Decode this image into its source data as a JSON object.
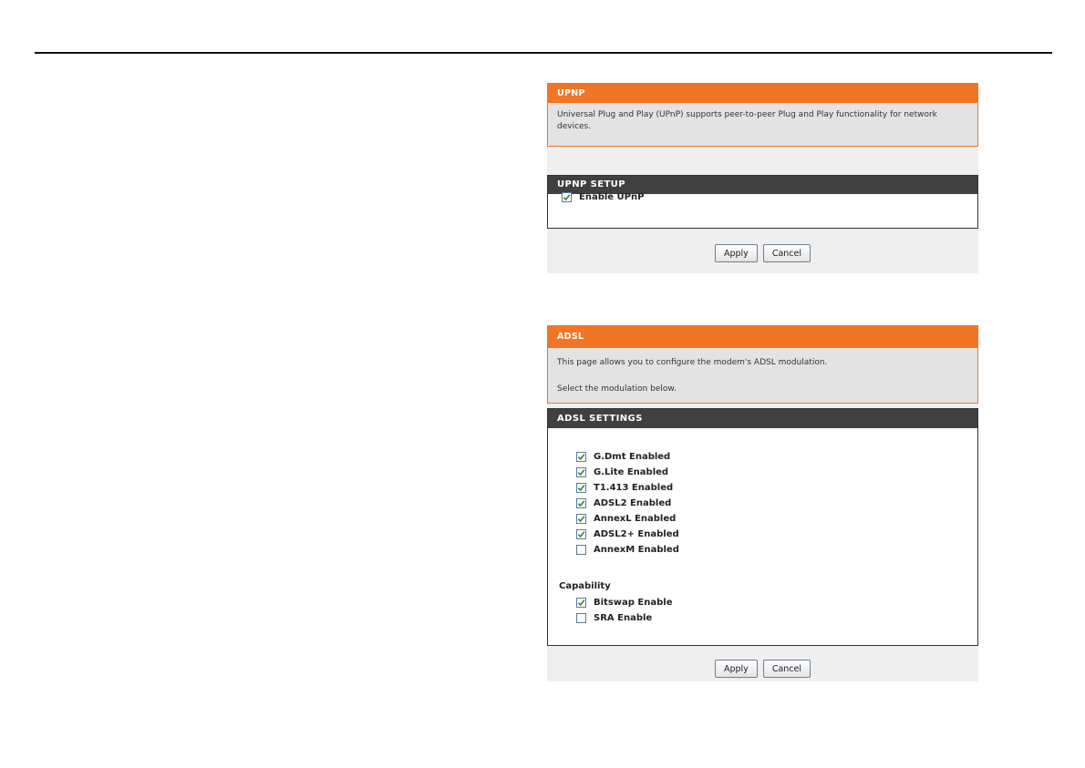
{
  "upnp": {
    "header": "UPNP",
    "description": "Universal Plug and Play (UPnP) supports peer-to-peer Plug and Play functionality for network devices.",
    "setup_header": "UPNP SETUP",
    "enable_label": "Enable UPnP",
    "enable_checked": true,
    "apply_label": "Apply",
    "cancel_label": "Cancel"
  },
  "adsl": {
    "header": "ADSL",
    "description_line1": "This page allows you to configure the modem's ADSL modulation.",
    "description_line2": "Select the modulation below.",
    "settings_header": "ADSL SETTINGS",
    "modulations": [
      {
        "label": "G.Dmt Enabled",
        "checked": true
      },
      {
        "label": "G.Lite Enabled",
        "checked": true
      },
      {
        "label": "T1.413 Enabled",
        "checked": true
      },
      {
        "label": "ADSL2 Enabled",
        "checked": true
      },
      {
        "label": "AnnexL Enabled",
        "checked": true
      },
      {
        "label": "ADSL2+ Enabled",
        "checked": true
      },
      {
        "label": "AnnexM Enabled",
        "checked": false
      }
    ],
    "capability_label": "Capability",
    "capabilities": [
      {
        "label": "Bitswap Enable",
        "checked": true
      },
      {
        "label": "SRA Enable",
        "checked": false
      }
    ],
    "apply_label": "Apply",
    "cancel_label": "Cancel"
  },
  "colors": {
    "accent_orange": "#f07626",
    "header_dark": "#404040",
    "panel_bg": "#efefef",
    "info_bg": "#e3e3e3",
    "checkmark_green": "#2e8b2e"
  }
}
